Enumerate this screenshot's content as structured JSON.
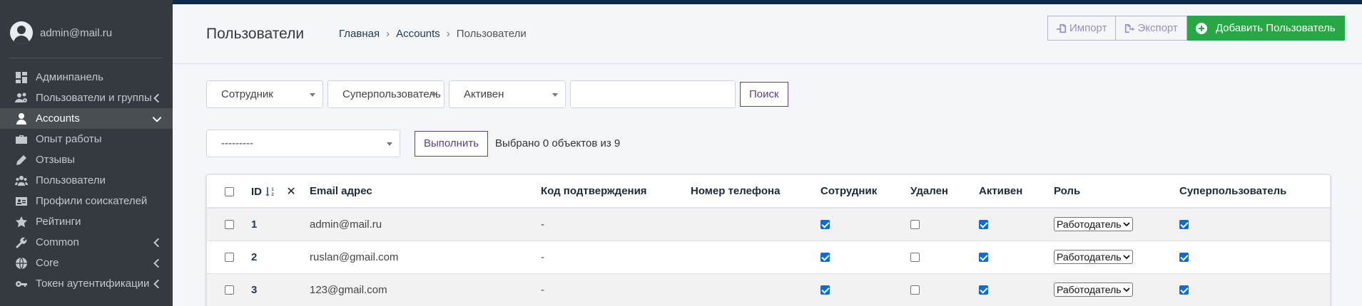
{
  "user": {
    "email": "admin@mail.ru"
  },
  "sidebar": {
    "items": [
      {
        "label": "Админпанель",
        "icon": "dashboard-icon",
        "active": false,
        "chevron": ""
      },
      {
        "label": "Пользователи и группы",
        "icon": "users-cog-icon",
        "active": false,
        "chevron": "left"
      },
      {
        "label": "Accounts",
        "icon": "user-icon",
        "active": true,
        "chevron": "down"
      },
      {
        "label": "Опыт работы",
        "icon": "briefcase-icon",
        "active": false,
        "chevron": ""
      },
      {
        "label": "Отзывы",
        "icon": "pen-icon",
        "active": false,
        "chevron": ""
      },
      {
        "label": "Пользователи",
        "icon": "users-icon",
        "active": false,
        "chevron": ""
      },
      {
        "label": "Профили соискателей",
        "icon": "id-card-icon",
        "active": false,
        "chevron": ""
      },
      {
        "label": "Рейтинги",
        "icon": "star-icon",
        "active": false,
        "chevron": ""
      },
      {
        "label": "Common",
        "icon": "wrench-icon",
        "active": false,
        "chevron": "left"
      },
      {
        "label": "Core",
        "icon": "globe-icon",
        "active": false,
        "chevron": "left"
      },
      {
        "label": "Токен аутентификации",
        "icon": "key-icon",
        "active": false,
        "chevron": "left"
      }
    ]
  },
  "header": {
    "title": "Пользователи",
    "breadcrumb": [
      "Главная",
      "Accounts",
      "Пользователи"
    ],
    "breadcrumb_sep": "›",
    "import_label": "Импорт",
    "export_label": "Экспорт",
    "add_label": "Добавить Пользователь"
  },
  "filters": {
    "staff": "Сотрудник",
    "superuser": "Суперпользователь",
    "active": "Активен",
    "search_value": "",
    "search_button": "Поиск"
  },
  "actions": {
    "selected_action": "---------",
    "run_button": "Выполнить",
    "counter": "Выбрано 0 объектов из 9"
  },
  "table": {
    "columns": {
      "id": "ID",
      "email": "Email адрес",
      "code": "Код подтверждения",
      "phone": "Номер телефона",
      "staff": "Сотрудник",
      "deleted": "Удален",
      "active": "Активен",
      "role": "Роль",
      "superuser": "Суперпользователь"
    },
    "rows": [
      {
        "id": "1",
        "email": "admin@mail.ru",
        "code": "-",
        "phone": "",
        "staff": true,
        "deleted": false,
        "active": true,
        "role": "Работодатель",
        "superuser": true
      },
      {
        "id": "2",
        "email": "ruslan@gmail.com",
        "code": "-",
        "phone": "",
        "staff": true,
        "deleted": false,
        "active": true,
        "role": "Работодатель",
        "superuser": true
      },
      {
        "id": "3",
        "email": "123@gmail.com",
        "code": "-",
        "phone": "",
        "staff": true,
        "deleted": false,
        "active": true,
        "role": "Работодатель",
        "superuser": true
      }
    ]
  },
  "colors": {
    "sidebar_bg": "#343a40",
    "active_item_bg": "#494e53",
    "accent_purple": "#5b3f98",
    "add_button_green": "#28a745",
    "checkbox_blue": "#0a6cd6"
  }
}
